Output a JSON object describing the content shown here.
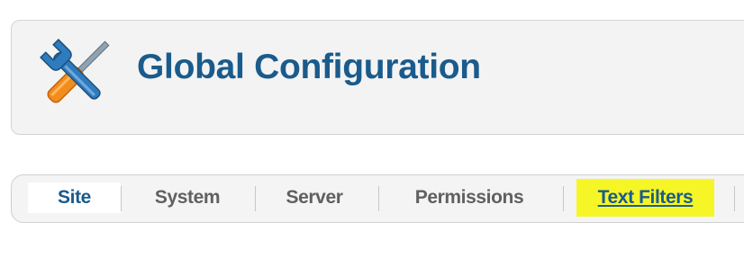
{
  "header": {
    "title": "Global Configuration",
    "icon": "wrench-screwdriver-icon"
  },
  "tabs": [
    {
      "label": "Site",
      "state": "active"
    },
    {
      "label": "System",
      "state": "normal"
    },
    {
      "label": "Server",
      "state": "normal"
    },
    {
      "label": "Permissions",
      "state": "normal"
    },
    {
      "label": "Text Filters",
      "state": "highlighted"
    }
  ],
  "colors": {
    "title": "#1a5b8c",
    "highlight": "#f6f626",
    "tab_text": "#606060"
  }
}
